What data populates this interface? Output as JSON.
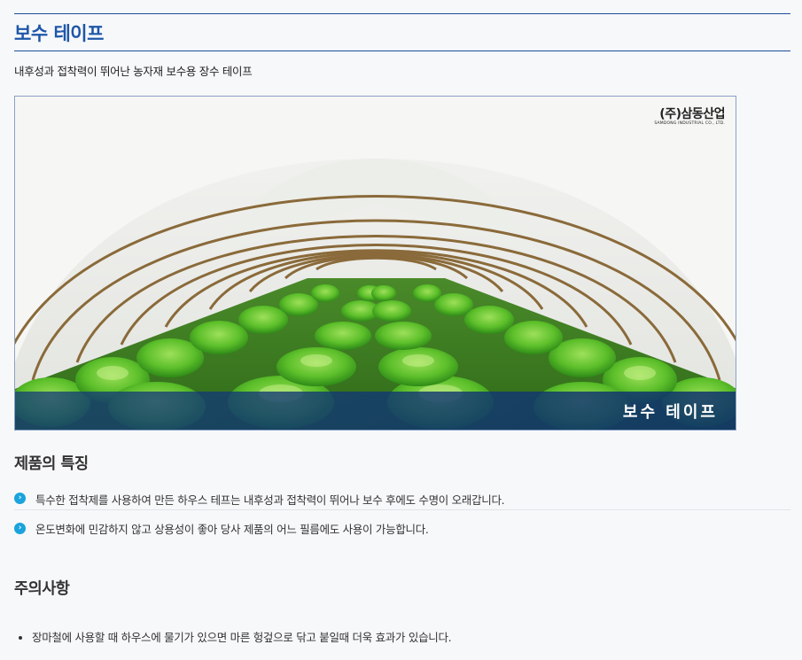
{
  "page": {
    "title": "보수 테이프",
    "subtitle": "내후성과 접착력이 뛰어난 농자재 보수용 장수 테이프"
  },
  "hero": {
    "logo_main": "(주)삼동산업",
    "logo_sub": "SAMDONG INDUSTRIAL CO., LTD.",
    "caption": "보수 테이프"
  },
  "features": {
    "title": "제품의 특징",
    "bullet_icon": "chevron-right-circle-icon",
    "items": [
      "특수한 접착제를 사용하여 만든 하우스 테프는 내후성과 접착력이 뛰어나 보수 후에도 수명이 오래갑니다.",
      "온도변화에 민감하지 않고 상용성이 좋아 당사 제품의 어느 필름에도 사용이 가능합니다."
    ]
  },
  "caution": {
    "title": "주의사항",
    "items": [
      "장마철에 사용할 때 하우스에 물기가 있으면 마른 헝겊으로 닦고 붙일때 더욱 효과가 있습니다."
    ]
  },
  "colors": {
    "accent": "#1e56a8",
    "rule": "#1e4f9a",
    "bullet": "#1aa3dc",
    "caption_bg": "#143c78"
  }
}
